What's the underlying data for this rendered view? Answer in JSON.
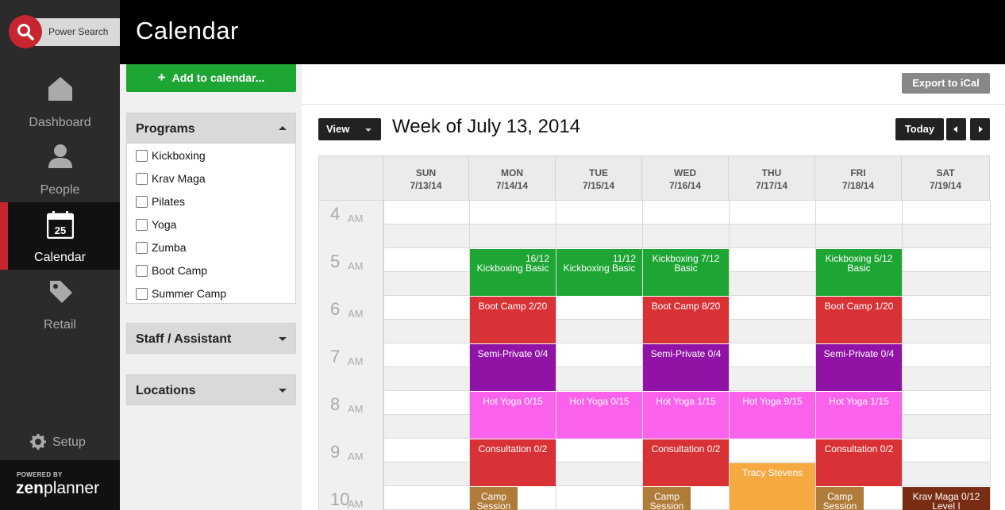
{
  "nav": {
    "search_label": "Power Search",
    "items": [
      {
        "label": "Dashboard",
        "icon": "home-icon"
      },
      {
        "label": "People",
        "icon": "person-icon"
      },
      {
        "label": "Calendar",
        "icon": "calendar-icon",
        "icon_text": "25",
        "active": true
      },
      {
        "label": "Retail",
        "icon": "tag-icon"
      }
    ],
    "setup_label": "Setup",
    "powered_by": "POWERED BY",
    "brand_zen": "zen",
    "brand_planner": "planner"
  },
  "header": {
    "title": "Calendar"
  },
  "filters": {
    "add_label": "Add to calendar...",
    "programs_title": "Programs",
    "programs": [
      "Kickboxing",
      "Krav Maga",
      "Pilates",
      "Yoga",
      "Zumba",
      "Boot Camp",
      "Summer Camp"
    ],
    "staff_title": "Staff / Assistant",
    "locations_title": "Locations"
  },
  "toolbar": {
    "export_label": "Export to iCal",
    "view_label": "View",
    "week_title": "Week of July 13, 2014",
    "today_label": "Today"
  },
  "calendar": {
    "days": [
      {
        "name": "SUN",
        "date": "7/13/14"
      },
      {
        "name": "MON",
        "date": "7/14/14"
      },
      {
        "name": "TUE",
        "date": "7/15/14"
      },
      {
        "name": "WED",
        "date": "7/16/14"
      },
      {
        "name": "THU",
        "date": "7/17/14"
      },
      {
        "name": "FRI",
        "date": "7/18/14"
      },
      {
        "name": "SAT",
        "date": "7/19/14"
      }
    ],
    "hours": [
      {
        "h": "4",
        "ap": "AM"
      },
      {
        "h": "5",
        "ap": "AM"
      },
      {
        "h": "6",
        "ap": "AM"
      },
      {
        "h": "7",
        "ap": "AM"
      },
      {
        "h": "8",
        "ap": "AM"
      },
      {
        "h": "9",
        "ap": "AM"
      },
      {
        "h": "10",
        "ap": "AM"
      }
    ],
    "events": [
      {
        "day": 1,
        "start": 5,
        "dur": 1,
        "color": "green",
        "line1": "16/12",
        "line2": "Kickboxing Basic",
        "align": "right"
      },
      {
        "day": 2,
        "start": 5,
        "dur": 1,
        "color": "green",
        "line1": "11/12",
        "line2": "Kickboxing Basic",
        "align": "right"
      },
      {
        "day": 3,
        "start": 5,
        "dur": 1,
        "color": "green",
        "line1": "Kickboxing  7/12",
        "line2": "Basic"
      },
      {
        "day": 5,
        "start": 5,
        "dur": 1,
        "color": "green",
        "line1": "Kickboxing  5/12",
        "line2": "Basic"
      },
      {
        "day": 1,
        "start": 6,
        "dur": 1,
        "color": "red",
        "line1": "Boot Camp 2/20"
      },
      {
        "day": 3,
        "start": 6,
        "dur": 1,
        "color": "red",
        "line1": "Boot Camp 8/20"
      },
      {
        "day": 5,
        "start": 6,
        "dur": 1,
        "color": "red",
        "line1": "Boot Camp  1/20"
      },
      {
        "day": 1,
        "start": 7,
        "dur": 1,
        "color": "purple",
        "line1": "Semi-Private 0/4"
      },
      {
        "day": 3,
        "start": 7,
        "dur": 1,
        "color": "purple",
        "line1": "Semi-Private 0/4"
      },
      {
        "day": 5,
        "start": 7,
        "dur": 1,
        "color": "purple",
        "line1": "Semi-Private 0/4"
      },
      {
        "day": 1,
        "start": 8,
        "dur": 1,
        "color": "pink",
        "line1": "Hot Yoga   0/15"
      },
      {
        "day": 2,
        "start": 8,
        "dur": 1,
        "color": "pink",
        "line1": "Hot Yoga   0/15"
      },
      {
        "day": 3,
        "start": 8,
        "dur": 1,
        "color": "pink",
        "line1": "Hot Yoga   1/15"
      },
      {
        "day": 4,
        "start": 8,
        "dur": 1,
        "color": "pink",
        "line1": "Hot Yoga   9/15"
      },
      {
        "day": 5,
        "start": 8,
        "dur": 1,
        "color": "pink",
        "line1": "Hot Yoga   1/15"
      },
      {
        "day": 1,
        "start": 9,
        "dur": 1,
        "color": "red",
        "line1": "Consultation 0/2"
      },
      {
        "day": 3,
        "start": 9,
        "dur": 1,
        "color": "red",
        "line1": "Consultation 0/2"
      },
      {
        "day": 5,
        "start": 9,
        "dur": 1,
        "color": "red",
        "line1": "Consultation 0/2"
      },
      {
        "day": 4,
        "start": 9.5,
        "dur": 1,
        "color": "orange",
        "line1": "Tracy Stevens"
      },
      {
        "day": 1,
        "start": 10,
        "dur": 1,
        "color": "brown",
        "line1": "Camp",
        "line2": "Session",
        "narrow": true
      },
      {
        "day": 3,
        "start": 10,
        "dur": 1,
        "color": "brown",
        "line1": "Camp",
        "line2": "Session",
        "narrow": true
      },
      {
        "day": 5,
        "start": 10,
        "dur": 1,
        "color": "brown",
        "line1": "Camp",
        "line2": "Session",
        "narrow": true
      },
      {
        "day": 6,
        "start": 10,
        "dur": 1,
        "color": "dark",
        "line1": "Krav Maga  0/12",
        "line2": "Level I"
      }
    ]
  }
}
